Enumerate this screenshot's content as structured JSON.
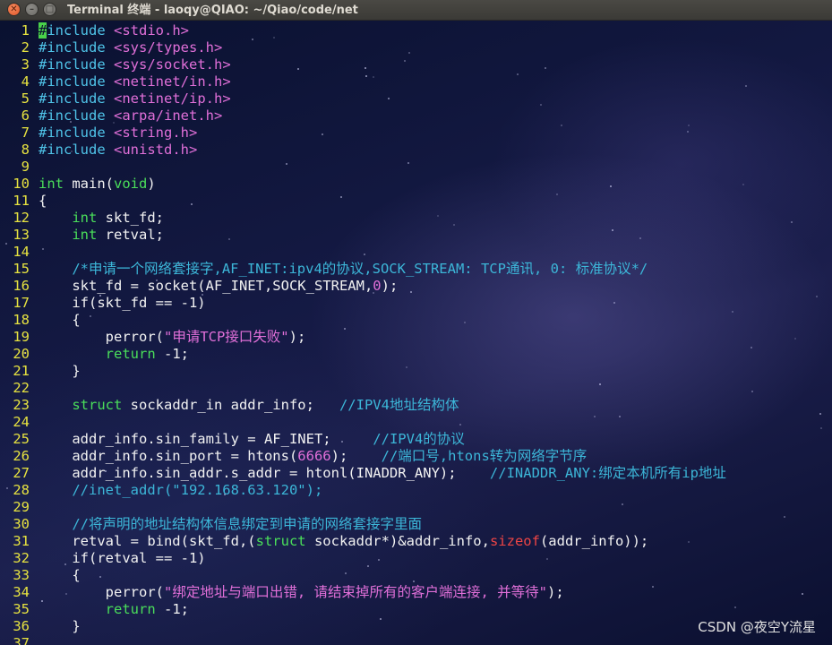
{
  "window": {
    "title": "Terminal 终端 - laoqy@QIAO: ~/Qiao/code/net",
    "close_glyph": "✕",
    "minimize_glyph": "–",
    "maximize_glyph": "□"
  },
  "editor": {
    "lines": [
      {
        "n": "1",
        "t": [
          [
            "cursor",
            "#"
          ],
          [
            "pp",
            "include "
          ],
          [
            "inc",
            "<stdio.h>"
          ]
        ]
      },
      {
        "n": "2",
        "t": [
          [
            "pp",
            "#include "
          ],
          [
            "inc",
            "<sys/types.h>"
          ]
        ]
      },
      {
        "n": "3",
        "t": [
          [
            "pp",
            "#include "
          ],
          [
            "inc",
            "<sys/socket.h>"
          ]
        ]
      },
      {
        "n": "4",
        "t": [
          [
            "pp",
            "#include "
          ],
          [
            "inc",
            "<netinet/in.h>"
          ]
        ]
      },
      {
        "n": "5",
        "t": [
          [
            "pp",
            "#include "
          ],
          [
            "inc",
            "<netinet/ip.h>"
          ]
        ]
      },
      {
        "n": "6",
        "t": [
          [
            "pp",
            "#include "
          ],
          [
            "inc",
            "<arpa/inet.h>"
          ]
        ]
      },
      {
        "n": "7",
        "t": [
          [
            "pp",
            "#include "
          ],
          [
            "inc",
            "<string.h>"
          ]
        ]
      },
      {
        "n": "8",
        "t": [
          [
            "pp",
            "#include "
          ],
          [
            "inc",
            "<unistd.h>"
          ]
        ]
      },
      {
        "n": "9",
        "t": []
      },
      {
        "n": "10",
        "t": [
          [
            "kw",
            "int"
          ],
          [
            "pl",
            " main("
          ],
          [
            "kw",
            "void"
          ],
          [
            "pl",
            ")"
          ]
        ]
      },
      {
        "n": "11",
        "t": [
          [
            "pl",
            "{"
          ]
        ]
      },
      {
        "n": "12",
        "t": [
          [
            "pl",
            "    "
          ],
          [
            "kw",
            "int"
          ],
          [
            "pl",
            " skt_fd;"
          ]
        ]
      },
      {
        "n": "13",
        "t": [
          [
            "pl",
            "    "
          ],
          [
            "kw",
            "int"
          ],
          [
            "pl",
            " retval;"
          ]
        ]
      },
      {
        "n": "14",
        "t": []
      },
      {
        "n": "15",
        "t": [
          [
            "pl",
            "    "
          ],
          [
            "cm",
            "/*申请一个网络套接字,AF_INET:ipv4的协议,SOCK_STREAM: TCP通讯, 0: 标准协议*/"
          ]
        ]
      },
      {
        "n": "16",
        "t": [
          [
            "pl",
            "    skt_fd = socket(AF_INET,SOCK_STREAM,"
          ],
          [
            "num",
            "0"
          ],
          [
            "pl",
            ");"
          ]
        ]
      },
      {
        "n": "17",
        "t": [
          [
            "pl",
            "    if(skt_fd == -1)"
          ]
        ]
      },
      {
        "n": "18",
        "t": [
          [
            "pl",
            "    {"
          ]
        ]
      },
      {
        "n": "19",
        "t": [
          [
            "pl",
            "        perror("
          ],
          [
            "st",
            "\"申请TCP接口失败\""
          ],
          [
            "pl",
            ");"
          ]
        ]
      },
      {
        "n": "20",
        "t": [
          [
            "pl",
            "        "
          ],
          [
            "kw",
            "return"
          ],
          [
            "pl",
            " -1;"
          ]
        ]
      },
      {
        "n": "21",
        "t": [
          [
            "pl",
            "    }"
          ]
        ]
      },
      {
        "n": "22",
        "t": []
      },
      {
        "n": "23",
        "t": [
          [
            "pl",
            "    "
          ],
          [
            "kw",
            "struct"
          ],
          [
            "pl",
            " sockaddr_in addr_info;   "
          ],
          [
            "cm",
            "//IPV4地址结构体"
          ]
        ]
      },
      {
        "n": "24",
        "t": []
      },
      {
        "n": "25",
        "t": [
          [
            "pl",
            "    addr_info.sin_family = AF_INET;     "
          ],
          [
            "cm",
            "//IPV4的协议"
          ]
        ]
      },
      {
        "n": "26",
        "t": [
          [
            "pl",
            "    addr_info.sin_port = htons("
          ],
          [
            "num",
            "6666"
          ],
          [
            "pl",
            ");    "
          ],
          [
            "cm",
            "//端口号,htons转为网络字节序"
          ]
        ]
      },
      {
        "n": "27",
        "t": [
          [
            "pl",
            "    addr_info.sin_addr.s_addr = htonl(INADDR_ANY);    "
          ],
          [
            "cm",
            "//INADDR_ANY:绑定本机所有ip地址"
          ]
        ]
      },
      {
        "n": "28",
        "t": [
          [
            "pl",
            "    "
          ],
          [
            "cm",
            "//inet_addr(\"192.168.63.120\");"
          ]
        ]
      },
      {
        "n": "29",
        "t": []
      },
      {
        "n": "30",
        "t": [
          [
            "pl",
            "    "
          ],
          [
            "cm",
            "//将声明的地址结构体信息绑定到申请的网络套接字里面"
          ]
        ]
      },
      {
        "n": "31",
        "t": [
          [
            "pl",
            "    retval = bind(skt_fd,("
          ],
          [
            "kw",
            "struct"
          ],
          [
            "pl",
            " sockaddr*)&addr_info,"
          ],
          [
            "sz",
            "sizeof"
          ],
          [
            "pl",
            "(addr_info));"
          ]
        ]
      },
      {
        "n": "32",
        "t": [
          [
            "pl",
            "    if(retval == -1)"
          ]
        ]
      },
      {
        "n": "33",
        "t": [
          [
            "pl",
            "    {"
          ]
        ]
      },
      {
        "n": "34",
        "t": [
          [
            "pl",
            "        perror("
          ],
          [
            "st",
            "\"绑定地址与端口出错, 请结束掉所有的客户端连接, 并等待\""
          ],
          [
            "pl",
            ");"
          ]
        ]
      },
      {
        "n": "35",
        "t": [
          [
            "pl",
            "        "
          ],
          [
            "kw",
            "return"
          ],
          [
            "pl",
            " -1;"
          ]
        ]
      },
      {
        "n": "36",
        "t": [
          [
            "pl",
            "    }"
          ]
        ]
      },
      {
        "n": "37",
        "t": []
      }
    ]
  },
  "watermark": "CSDN @夜空Y流星"
}
